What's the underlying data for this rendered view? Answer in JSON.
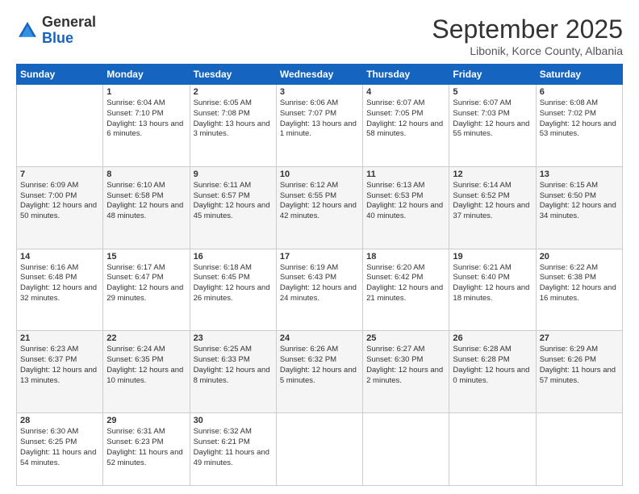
{
  "logo": {
    "general": "General",
    "blue": "Blue"
  },
  "header": {
    "month": "September 2025",
    "location": "Libonik, Korce County, Albania"
  },
  "weekdays": [
    "Sunday",
    "Monday",
    "Tuesday",
    "Wednesday",
    "Thursday",
    "Friday",
    "Saturday"
  ],
  "weeks": [
    [
      {
        "day": "",
        "sunrise": "",
        "sunset": "",
        "daylight": ""
      },
      {
        "day": "1",
        "sunrise": "Sunrise: 6:04 AM",
        "sunset": "Sunset: 7:10 PM",
        "daylight": "Daylight: 13 hours and 6 minutes."
      },
      {
        "day": "2",
        "sunrise": "Sunrise: 6:05 AM",
        "sunset": "Sunset: 7:08 PM",
        "daylight": "Daylight: 13 hours and 3 minutes."
      },
      {
        "day": "3",
        "sunrise": "Sunrise: 6:06 AM",
        "sunset": "Sunset: 7:07 PM",
        "daylight": "Daylight: 13 hours and 1 minute."
      },
      {
        "day": "4",
        "sunrise": "Sunrise: 6:07 AM",
        "sunset": "Sunset: 7:05 PM",
        "daylight": "Daylight: 12 hours and 58 minutes."
      },
      {
        "day": "5",
        "sunrise": "Sunrise: 6:07 AM",
        "sunset": "Sunset: 7:03 PM",
        "daylight": "Daylight: 12 hours and 55 minutes."
      },
      {
        "day": "6",
        "sunrise": "Sunrise: 6:08 AM",
        "sunset": "Sunset: 7:02 PM",
        "daylight": "Daylight: 12 hours and 53 minutes."
      }
    ],
    [
      {
        "day": "7",
        "sunrise": "Sunrise: 6:09 AM",
        "sunset": "Sunset: 7:00 PM",
        "daylight": "Daylight: 12 hours and 50 minutes."
      },
      {
        "day": "8",
        "sunrise": "Sunrise: 6:10 AM",
        "sunset": "Sunset: 6:58 PM",
        "daylight": "Daylight: 12 hours and 48 minutes."
      },
      {
        "day": "9",
        "sunrise": "Sunrise: 6:11 AM",
        "sunset": "Sunset: 6:57 PM",
        "daylight": "Daylight: 12 hours and 45 minutes."
      },
      {
        "day": "10",
        "sunrise": "Sunrise: 6:12 AM",
        "sunset": "Sunset: 6:55 PM",
        "daylight": "Daylight: 12 hours and 42 minutes."
      },
      {
        "day": "11",
        "sunrise": "Sunrise: 6:13 AM",
        "sunset": "Sunset: 6:53 PM",
        "daylight": "Daylight: 12 hours and 40 minutes."
      },
      {
        "day": "12",
        "sunrise": "Sunrise: 6:14 AM",
        "sunset": "Sunset: 6:52 PM",
        "daylight": "Daylight: 12 hours and 37 minutes."
      },
      {
        "day": "13",
        "sunrise": "Sunrise: 6:15 AM",
        "sunset": "Sunset: 6:50 PM",
        "daylight": "Daylight: 12 hours and 34 minutes."
      }
    ],
    [
      {
        "day": "14",
        "sunrise": "Sunrise: 6:16 AM",
        "sunset": "Sunset: 6:48 PM",
        "daylight": "Daylight: 12 hours and 32 minutes."
      },
      {
        "day": "15",
        "sunrise": "Sunrise: 6:17 AM",
        "sunset": "Sunset: 6:47 PM",
        "daylight": "Daylight: 12 hours and 29 minutes."
      },
      {
        "day": "16",
        "sunrise": "Sunrise: 6:18 AM",
        "sunset": "Sunset: 6:45 PM",
        "daylight": "Daylight: 12 hours and 26 minutes."
      },
      {
        "day": "17",
        "sunrise": "Sunrise: 6:19 AM",
        "sunset": "Sunset: 6:43 PM",
        "daylight": "Daylight: 12 hours and 24 minutes."
      },
      {
        "day": "18",
        "sunrise": "Sunrise: 6:20 AM",
        "sunset": "Sunset: 6:42 PM",
        "daylight": "Daylight: 12 hours and 21 minutes."
      },
      {
        "day": "19",
        "sunrise": "Sunrise: 6:21 AM",
        "sunset": "Sunset: 6:40 PM",
        "daylight": "Daylight: 12 hours and 18 minutes."
      },
      {
        "day": "20",
        "sunrise": "Sunrise: 6:22 AM",
        "sunset": "Sunset: 6:38 PM",
        "daylight": "Daylight: 12 hours and 16 minutes."
      }
    ],
    [
      {
        "day": "21",
        "sunrise": "Sunrise: 6:23 AM",
        "sunset": "Sunset: 6:37 PM",
        "daylight": "Daylight: 12 hours and 13 minutes."
      },
      {
        "day": "22",
        "sunrise": "Sunrise: 6:24 AM",
        "sunset": "Sunset: 6:35 PM",
        "daylight": "Daylight: 12 hours and 10 minutes."
      },
      {
        "day": "23",
        "sunrise": "Sunrise: 6:25 AM",
        "sunset": "Sunset: 6:33 PM",
        "daylight": "Daylight: 12 hours and 8 minutes."
      },
      {
        "day": "24",
        "sunrise": "Sunrise: 6:26 AM",
        "sunset": "Sunset: 6:32 PM",
        "daylight": "Daylight: 12 hours and 5 minutes."
      },
      {
        "day": "25",
        "sunrise": "Sunrise: 6:27 AM",
        "sunset": "Sunset: 6:30 PM",
        "daylight": "Daylight: 12 hours and 2 minutes."
      },
      {
        "day": "26",
        "sunrise": "Sunrise: 6:28 AM",
        "sunset": "Sunset: 6:28 PM",
        "daylight": "Daylight: 12 hours and 0 minutes."
      },
      {
        "day": "27",
        "sunrise": "Sunrise: 6:29 AM",
        "sunset": "Sunset: 6:26 PM",
        "daylight": "Daylight: 11 hours and 57 minutes."
      }
    ],
    [
      {
        "day": "28",
        "sunrise": "Sunrise: 6:30 AM",
        "sunset": "Sunset: 6:25 PM",
        "daylight": "Daylight: 11 hours and 54 minutes."
      },
      {
        "day": "29",
        "sunrise": "Sunrise: 6:31 AM",
        "sunset": "Sunset: 6:23 PM",
        "daylight": "Daylight: 11 hours and 52 minutes."
      },
      {
        "day": "30",
        "sunrise": "Sunrise: 6:32 AM",
        "sunset": "Sunset: 6:21 PM",
        "daylight": "Daylight: 11 hours and 49 minutes."
      },
      {
        "day": "",
        "sunrise": "",
        "sunset": "",
        "daylight": ""
      },
      {
        "day": "",
        "sunrise": "",
        "sunset": "",
        "daylight": ""
      },
      {
        "day": "",
        "sunrise": "",
        "sunset": "",
        "daylight": ""
      },
      {
        "day": "",
        "sunrise": "",
        "sunset": "",
        "daylight": ""
      }
    ]
  ]
}
